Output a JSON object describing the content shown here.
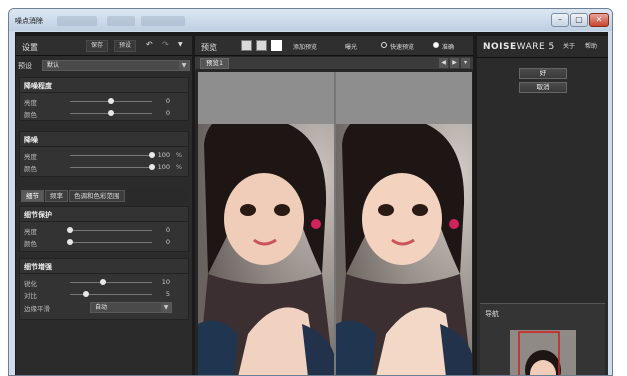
{
  "window": {
    "title": "噪点消除",
    "minimize": "–",
    "maximize": "▢",
    "close": "✕"
  },
  "settings": {
    "title": "设置",
    "save": "保存",
    "preset_btn": "预设",
    "undo": "↶",
    "redo": "↷",
    "menu": "▼",
    "preset_label": "预设",
    "preset_value": "默认"
  },
  "noise_level": {
    "title": "降噪程度",
    "rows": [
      {
        "label": "亮度",
        "value": "0",
        "level": 0.5
      },
      {
        "label": "颜色",
        "value": "0",
        "level": 0.5
      }
    ]
  },
  "noise_reduction": {
    "title": "降噪",
    "rows": [
      {
        "label": "亮度",
        "value": "100",
        "unit": "%",
        "level": 1.0
      },
      {
        "label": "颜色",
        "value": "100",
        "unit": "%",
        "level": 1.0
      }
    ]
  },
  "tabs": [
    "细节",
    "频率",
    "色调和色彩范围"
  ],
  "detail_protect": {
    "title": "细节保护",
    "rows": [
      {
        "label": "亮度",
        "value": "0",
        "level": 0.0
      },
      {
        "label": "颜色",
        "value": "0",
        "level": 0.0
      }
    ]
  },
  "detail_enhance": {
    "title": "细节增强",
    "rows": [
      {
        "label": "锐化",
        "value": "10",
        "level": 0.4
      },
      {
        "label": "对比",
        "value": "5",
        "level": 0.2
      }
    ],
    "edge_label": "边缘平滑",
    "edge_value": "自动"
  },
  "preview": {
    "title": "预览",
    "add_preview": "添加预览",
    "exposure": "曝光",
    "fast_preview": "快速预览",
    "accurate": "准确",
    "tab": "预览1",
    "prev": "◀",
    "next": "▶",
    "more": "▾"
  },
  "right": {
    "logo_bold": "NOISE",
    "logo_rest": "WARE 5",
    "about": "关于",
    "help": "帮助",
    "ok": "好",
    "cancel": "取消",
    "navigator": "导航"
  },
  "colors": {
    "accent_red": "#d21c1c",
    "panel": "#2b2b2b"
  }
}
